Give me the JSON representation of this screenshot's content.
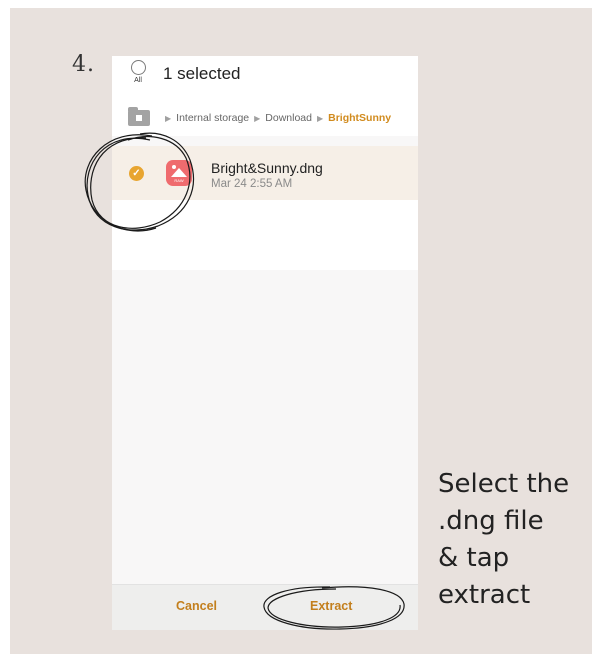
{
  "step_number": "4.",
  "header": {
    "all_label": "All",
    "selection_count": "1 selected"
  },
  "breadcrumb": {
    "items": [
      "Internal storage",
      "Download",
      "BrightSunny"
    ]
  },
  "file": {
    "name": "Bright&Sunny.dng",
    "date": "Mar 24 2:55 AM",
    "selected": true,
    "thumb_label": "RAW"
  },
  "actions": {
    "cancel": "Cancel",
    "extract": "Extract"
  },
  "instruction": "Select the\n.dng file\n& tap\nextract",
  "colors": {
    "accent": "#e8a530",
    "button_text": "#c37f1d",
    "breadcrumb_active": "#d18b1e",
    "background": "#e8e1dd",
    "thumb": "#ef6b6e"
  }
}
